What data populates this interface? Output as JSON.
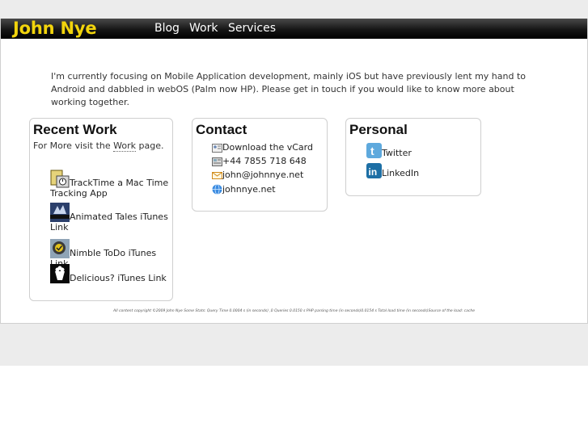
{
  "header": {
    "brand": "John Nye",
    "nav": [
      "Blog",
      "Work",
      "Services"
    ]
  },
  "intro": "I'm currently focusing on Mobile Application development, mainly iOS but have previously lent my hand to Android and dabbled in webOS (Palm now HP). Please get in touch if you would like to know more about working together.",
  "recent_work": {
    "title": "Recent Work",
    "more_prefix": "For More visit the ",
    "more_link": "Work",
    "more_suffix": " page.",
    "items": [
      {
        "label": "TrackTime a Mac Time Tracking App",
        "icon": "tracktime-app-icon"
      },
      {
        "label": "Animated Tales iTunes Link",
        "icon": "animated-tales-app-icon"
      },
      {
        "label": "Nimble ToDo iTunes Link",
        "icon": "nimble-todo-app-icon"
      },
      {
        "label": "Delicious? iTunes Link",
        "icon": "delicious-app-icon"
      }
    ]
  },
  "contact": {
    "title": "Contact",
    "items": [
      {
        "label": "Download the vCard",
        "icon": "vcard-icon"
      },
      {
        "label": "+44 7855 718 648",
        "icon": "phone-icon"
      },
      {
        "label": "john@johnnye.net",
        "icon": "email-icon"
      },
      {
        "label": "johnnye.net",
        "icon": "globe-icon"
      }
    ]
  },
  "personal": {
    "title": "Personal",
    "items": [
      {
        "label": "Twitter",
        "icon": "twitter-icon"
      },
      {
        "label": "LinkedIn",
        "icon": "linkedin-icon"
      }
    ]
  },
  "footer": "All content copyright ©2009 John Nye Some Stats: Query Time 0.0004 s (in seconds) ,0 Queries 0.0150 s PHP parsing time (in seconds)0.0154 s Total load time (in seconds)Source of the load: cache",
  "colors": {
    "brand": "#f2d40c",
    "navbar": "#1a1a1a",
    "background": "#ececec"
  }
}
